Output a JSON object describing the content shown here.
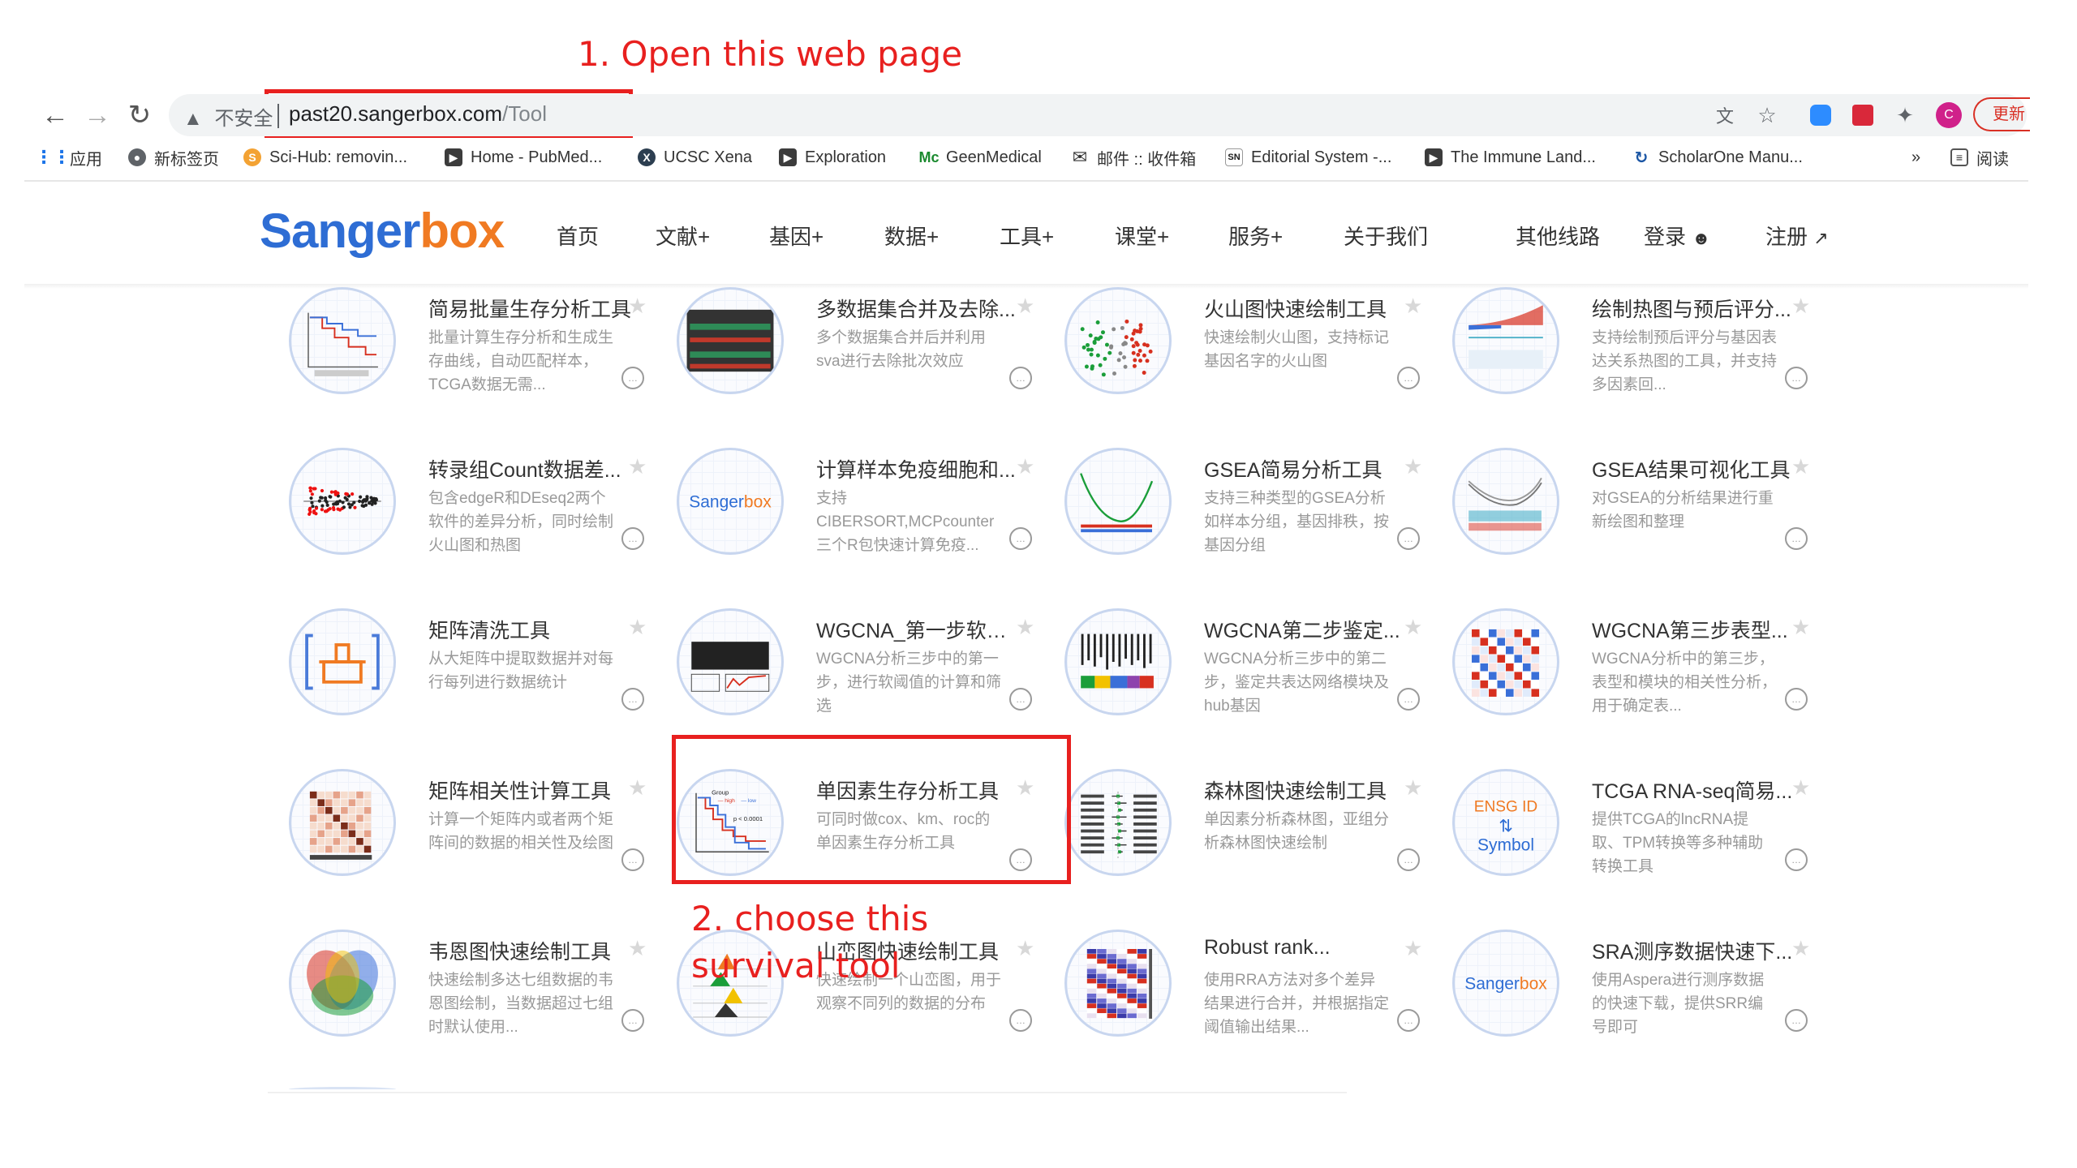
{
  "annotations": {
    "step1": "1. Open this web page",
    "step2_line1": "2. choose this",
    "step2_line2": "survival tool"
  },
  "browser": {
    "security": "不安全",
    "url_host": "past20.sangerbox.com",
    "url_path": "/Tool",
    "update_label": "更新",
    "profile_initial": "C",
    "bookmarks": [
      {
        "label": "应用",
        "icon": "apps-grid-icon"
      },
      {
        "label": "新标签页",
        "icon": "globe-icon"
      },
      {
        "label": "Sci-Hub: removin...",
        "icon": "sci-hub-icon"
      },
      {
        "label": "Home - PubMed...",
        "icon": "bookmark-arrow-icon"
      },
      {
        "label": "UCSC Xena",
        "icon": "xena-icon"
      },
      {
        "label": "Exploration",
        "icon": "bookmark-arrow-icon"
      },
      {
        "label": "GeenMedical",
        "icon": "geenmedical-icon"
      },
      {
        "label": "邮件 :: 收件箱",
        "icon": "mail-icon"
      },
      {
        "label": "Editorial System -...",
        "icon": "sn-icon"
      },
      {
        "label": "The Immune Land...",
        "icon": "bookmark-arrow-icon"
      },
      {
        "label": "ScholarOne Manu...",
        "icon": "scholarone-icon"
      }
    ],
    "more_bookmarks": "»",
    "reading_list": "阅读"
  },
  "site": {
    "logo_part1": "Sanger",
    "logo_part2": "box",
    "menu": [
      "首页",
      "文献+",
      "基因+",
      "数据+",
      "工具+",
      "课堂+",
      "服务+",
      "关于我们",
      "其他线路",
      "登录",
      "注册"
    ]
  },
  "cards": [
    {
      "title": "简易批量生存分析工具",
      "desc": "批量计算生存分析和生成生存曲线，自动匹配样本，TCGA数据无需...",
      "thumb": "survival-batch"
    },
    {
      "title": "多数据集合并及去除...",
      "desc": "多个数据集合并后并利用sva进行去除批次效应",
      "thumb": "boxplot"
    },
    {
      "title": "火山图快速绘制工具",
      "desc": "快速绘制火山图，支持标记基因名字的火山图",
      "thumb": "volcano"
    },
    {
      "title": "绘制热图与预后评分...",
      "desc": "支持绘制预后评分与基因表达关系热图的工具，并支持多因素回...",
      "thumb": "risk-score"
    },
    {
      "title": "转录组Count数据差...",
      "desc": "包含edgeR和DEseq2两个软件的差异分析，同时绘制火山图和热图",
      "thumb": "ma-plot"
    },
    {
      "title": "计算样本免疫细胞和...",
      "desc": "支持CIBERSORT,MCPcounter三个R包快速计算免疫...",
      "thumb": "sangerbox-logo"
    },
    {
      "title": "GSEA简易分析工具",
      "desc": "支持三种类型的GSEA分析如样本分组，基因排秩，按基因分组",
      "thumb": "gsea"
    },
    {
      "title": "GSEA结果可视化工具",
      "desc": "对GSEA的分析结果进行重新绘图和整理",
      "thumb": "gsea-multi"
    },
    {
      "title": "矩阵清洗工具",
      "desc": "从大矩阵中提取数据并对每行每列进行数据统计",
      "thumb": "clean-icon"
    },
    {
      "title": "WGCNA_第一步软阈...",
      "desc": "WGCNA分析三步中的第一步，进行软阈值的计算和筛选",
      "thumb": "wgcna1"
    },
    {
      "title": "WGCNA第二步鉴定...",
      "desc": "WGCNA分析三步中的第二步，鉴定共表达网络模块及hub基因",
      "thumb": "wgcna2"
    },
    {
      "title": "WGCNA第三步表型...",
      "desc": "WGCNA分析中的第三步，表型和模块的相关性分析，用于确定表...",
      "thumb": "wgcna3"
    },
    {
      "title": "矩阵相关性计算工具",
      "desc": "计算一个矩阵内或者两个矩阵间的数据的相关性及绘图",
      "thumb": "corr-matrix"
    },
    {
      "title": "单因素生存分析工具",
      "desc": "可同时做cox、km、roc的单因素生存分析工具",
      "thumb": "km-curve",
      "km_legend": "Group",
      "km_high": "high",
      "km_low": "low",
      "km_p": "p < 0.0001"
    },
    {
      "title": "森林图快速绘制工具",
      "desc": "单因素分析森林图，亚组分析森林图快速绘制",
      "thumb": "forest"
    },
    {
      "title": "TCGA RNA-seq简易...",
      "desc": "提供TCGA的lncRNA提取、TPM转换等多种辅助转换工具",
      "thumb": "ensg",
      "ensg_top": "ENSG ID",
      "ensg_bottom": "Symbol"
    },
    {
      "title": "韦恩图快速绘制工具",
      "desc": "快速绘制多达七组数据的韦恩图绘制，当数据超过七组时默认使用...",
      "thumb": "venn"
    },
    {
      "title": "山峦图快速绘制工具",
      "desc": "快速绘制一个山峦图，用于观察不同列的数据的分布",
      "thumb": "ridge"
    },
    {
      "title": "Robust rank...",
      "desc": "使用RRA方法对多个差异结果进行合并，并根据指定阈值输出结果...",
      "thumb": "rra"
    },
    {
      "title": "SRA测序数据快速下...",
      "desc": "使用Aspera进行测序数据的快速下载，提供SRR编号即可",
      "thumb": "sangerbox-logo"
    }
  ]
}
